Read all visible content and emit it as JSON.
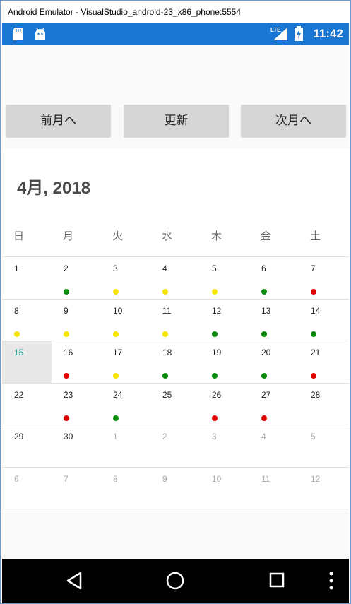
{
  "window": {
    "title": "Android Emulator - VisualStudio_android-23_x86_phone:5554"
  },
  "statusbar": {
    "time": "11:42",
    "network_label": "LTE",
    "bg_color": "#1976d2"
  },
  "buttons": {
    "prev": "前月へ",
    "refresh": "更新",
    "next": "次月へ"
  },
  "calendar": {
    "month_title": "4月, 2018",
    "weekdays": [
      "日",
      "月",
      "火",
      "水",
      "木",
      "金",
      "土"
    ],
    "today_color": "#26a69a",
    "weeks": [
      [
        {
          "d": "1",
          "dot": null
        },
        {
          "d": "2",
          "dot": "green"
        },
        {
          "d": "3",
          "dot": "yellow"
        },
        {
          "d": "4",
          "dot": "yellow"
        },
        {
          "d": "5",
          "dot": "yellow"
        },
        {
          "d": "6",
          "dot": "green"
        },
        {
          "d": "7",
          "dot": "red"
        }
      ],
      [
        {
          "d": "8",
          "dot": "yellow"
        },
        {
          "d": "9",
          "dot": "yellow"
        },
        {
          "d": "10",
          "dot": "yellow"
        },
        {
          "d": "11",
          "dot": "yellow"
        },
        {
          "d": "12",
          "dot": "green"
        },
        {
          "d": "13",
          "dot": "green"
        },
        {
          "d": "14",
          "dot": "green"
        }
      ],
      [
        {
          "d": "15",
          "dot": null,
          "today": true
        },
        {
          "d": "16",
          "dot": "red"
        },
        {
          "d": "17",
          "dot": "yellow"
        },
        {
          "d": "18",
          "dot": "green"
        },
        {
          "d": "19",
          "dot": "green"
        },
        {
          "d": "20",
          "dot": "green"
        },
        {
          "d": "21",
          "dot": "red"
        }
      ],
      [
        {
          "d": "22",
          "dot": null
        },
        {
          "d": "23",
          "dot": "red"
        },
        {
          "d": "24",
          "dot": "green"
        },
        {
          "d": "25",
          "dot": null
        },
        {
          "d": "26",
          "dot": "red"
        },
        {
          "d": "27",
          "dot": "red"
        },
        {
          "d": "28",
          "dot": null
        }
      ],
      [
        {
          "d": "29",
          "dot": null
        },
        {
          "d": "30",
          "dot": null
        },
        {
          "d": "1",
          "dot": null,
          "other": true
        },
        {
          "d": "2",
          "dot": null,
          "other": true
        },
        {
          "d": "3",
          "dot": null,
          "other": true
        },
        {
          "d": "4",
          "dot": null,
          "other": true
        },
        {
          "d": "5",
          "dot": null,
          "other": true
        }
      ],
      [
        {
          "d": "6",
          "dot": null,
          "other": true
        },
        {
          "d": "7",
          "dot": null,
          "other": true
        },
        {
          "d": "8",
          "dot": null,
          "other": true
        },
        {
          "d": "9",
          "dot": null,
          "other": true
        },
        {
          "d": "10",
          "dot": null,
          "other": true
        },
        {
          "d": "11",
          "dot": null,
          "other": true
        },
        {
          "d": "12",
          "dot": null,
          "other": true
        }
      ]
    ],
    "dot_colors": {
      "green": "#0a8a0a",
      "yellow": "#f5e500",
      "red": "#e00000"
    }
  }
}
